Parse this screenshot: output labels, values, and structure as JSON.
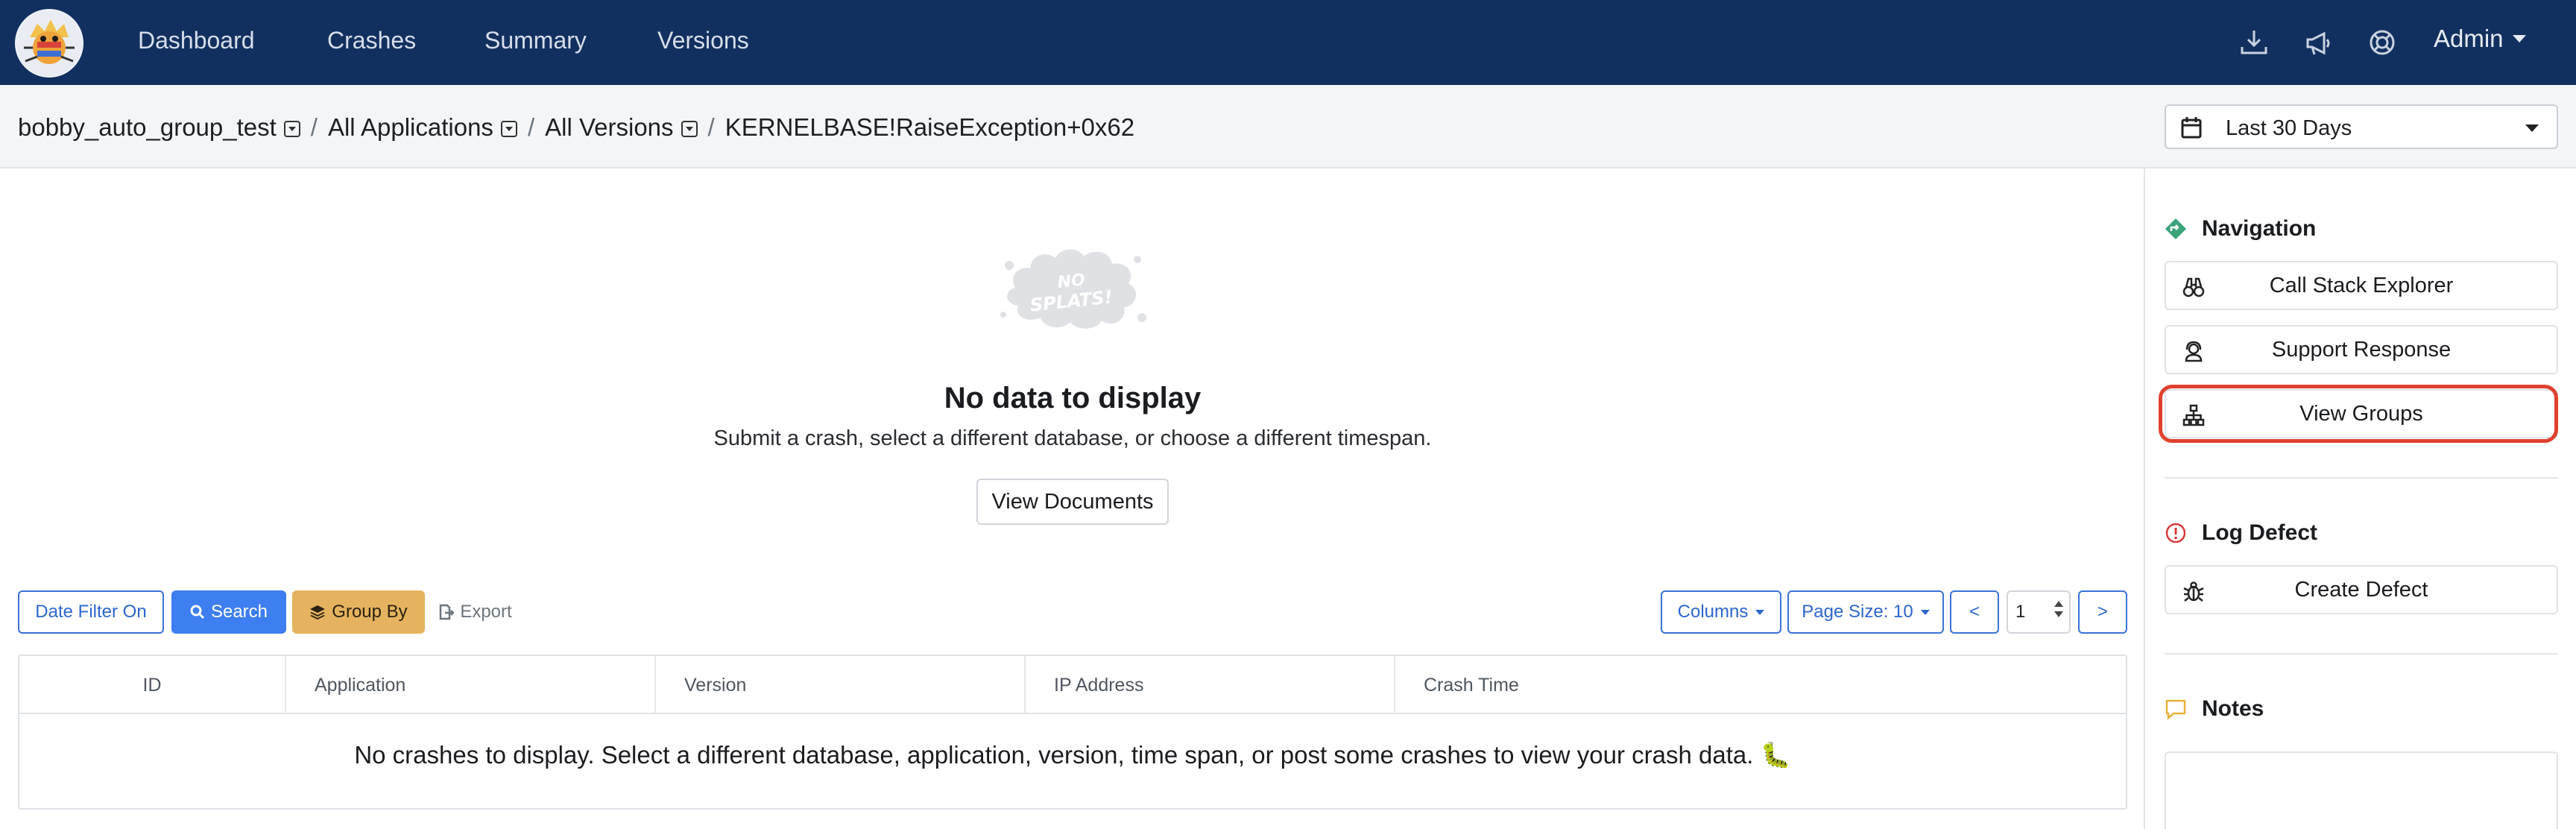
{
  "navbar": {
    "logo_alt": "BugSplat",
    "links": [
      "Dashboard",
      "Crashes",
      "Summary",
      "Versions"
    ],
    "icons": [
      "download-icon",
      "megaphone-icon",
      "lifebuoy-icon"
    ],
    "user_menu": "Admin"
  },
  "breadcrumb": {
    "database": "bobby_auto_group_test",
    "application": "All Applications",
    "version": "All Versions",
    "group": "KERNELBASE!RaiseException+0x62",
    "separator": "/"
  },
  "date_range": {
    "label": "Last 30 Days"
  },
  "empty_state": {
    "image_text": "NO SPLATS!",
    "title": "No data to display",
    "subtitle": "Submit a crash, select a different database, or choose a different timespan.",
    "button": "View Documents"
  },
  "toolbar": {
    "date_filter": "Date Filter On",
    "search": "Search",
    "group_by": "Group By",
    "export": "Export",
    "columns": "Columns",
    "page_size": "Page Size: 10",
    "prev": "<",
    "page": "1",
    "next": ">"
  },
  "table": {
    "columns": [
      "ID",
      "Application",
      "Version",
      "IP Address",
      "Crash Time"
    ],
    "empty_message": "No crashes to display. Select a different database, application, version, time span, or post some crashes to view your crash data. 🐛"
  },
  "sidebar": {
    "navigation_heading": "Navigation",
    "nav_buttons": [
      "Call Stack Explorer",
      "Support Response",
      "View Groups"
    ],
    "log_defect_heading": "Log Defect",
    "create_defect": "Create Defect",
    "notes_heading": "Notes"
  },
  "colors": {
    "navbar_bg": "#12305f",
    "primary": "#3d7ef0",
    "warning": "#e5b35f",
    "highlight": "#e0412f",
    "nav_accent": "#3aa37a",
    "defect_accent": "#d93a3a",
    "notes_accent": "#e8b13a"
  }
}
